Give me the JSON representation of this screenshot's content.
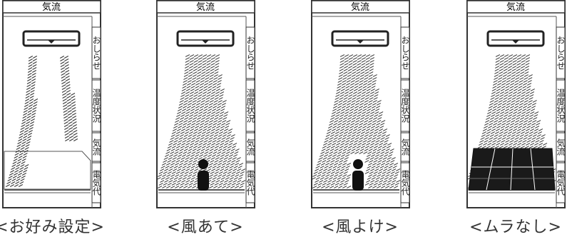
{
  "panels": [
    {
      "mode": "custom",
      "title": "気流",
      "caption": "<お好み設定>",
      "tabs": [
        "おしらせ",
        "温度状況",
        "気流",
        "電気代"
      ],
      "active_tab": "気流"
    },
    {
      "mode": "direct",
      "title": "気流",
      "caption": "<風あて>",
      "tabs": [
        "おしらせ",
        "温度状況",
        "気流",
        "電気代"
      ],
      "active_tab": "気流"
    },
    {
      "mode": "avoid",
      "title": "気流",
      "caption": "<風よけ>",
      "tabs": [
        "おしらせ",
        "温度状況",
        "気流",
        "電気代"
      ],
      "active_tab": "気流"
    },
    {
      "mode": "even",
      "title": "気流",
      "caption": "<ムラなし>",
      "tabs": [
        "おしらせ",
        "温度状況",
        "気流",
        "電気代"
      ],
      "active_tab": "気流"
    }
  ]
}
